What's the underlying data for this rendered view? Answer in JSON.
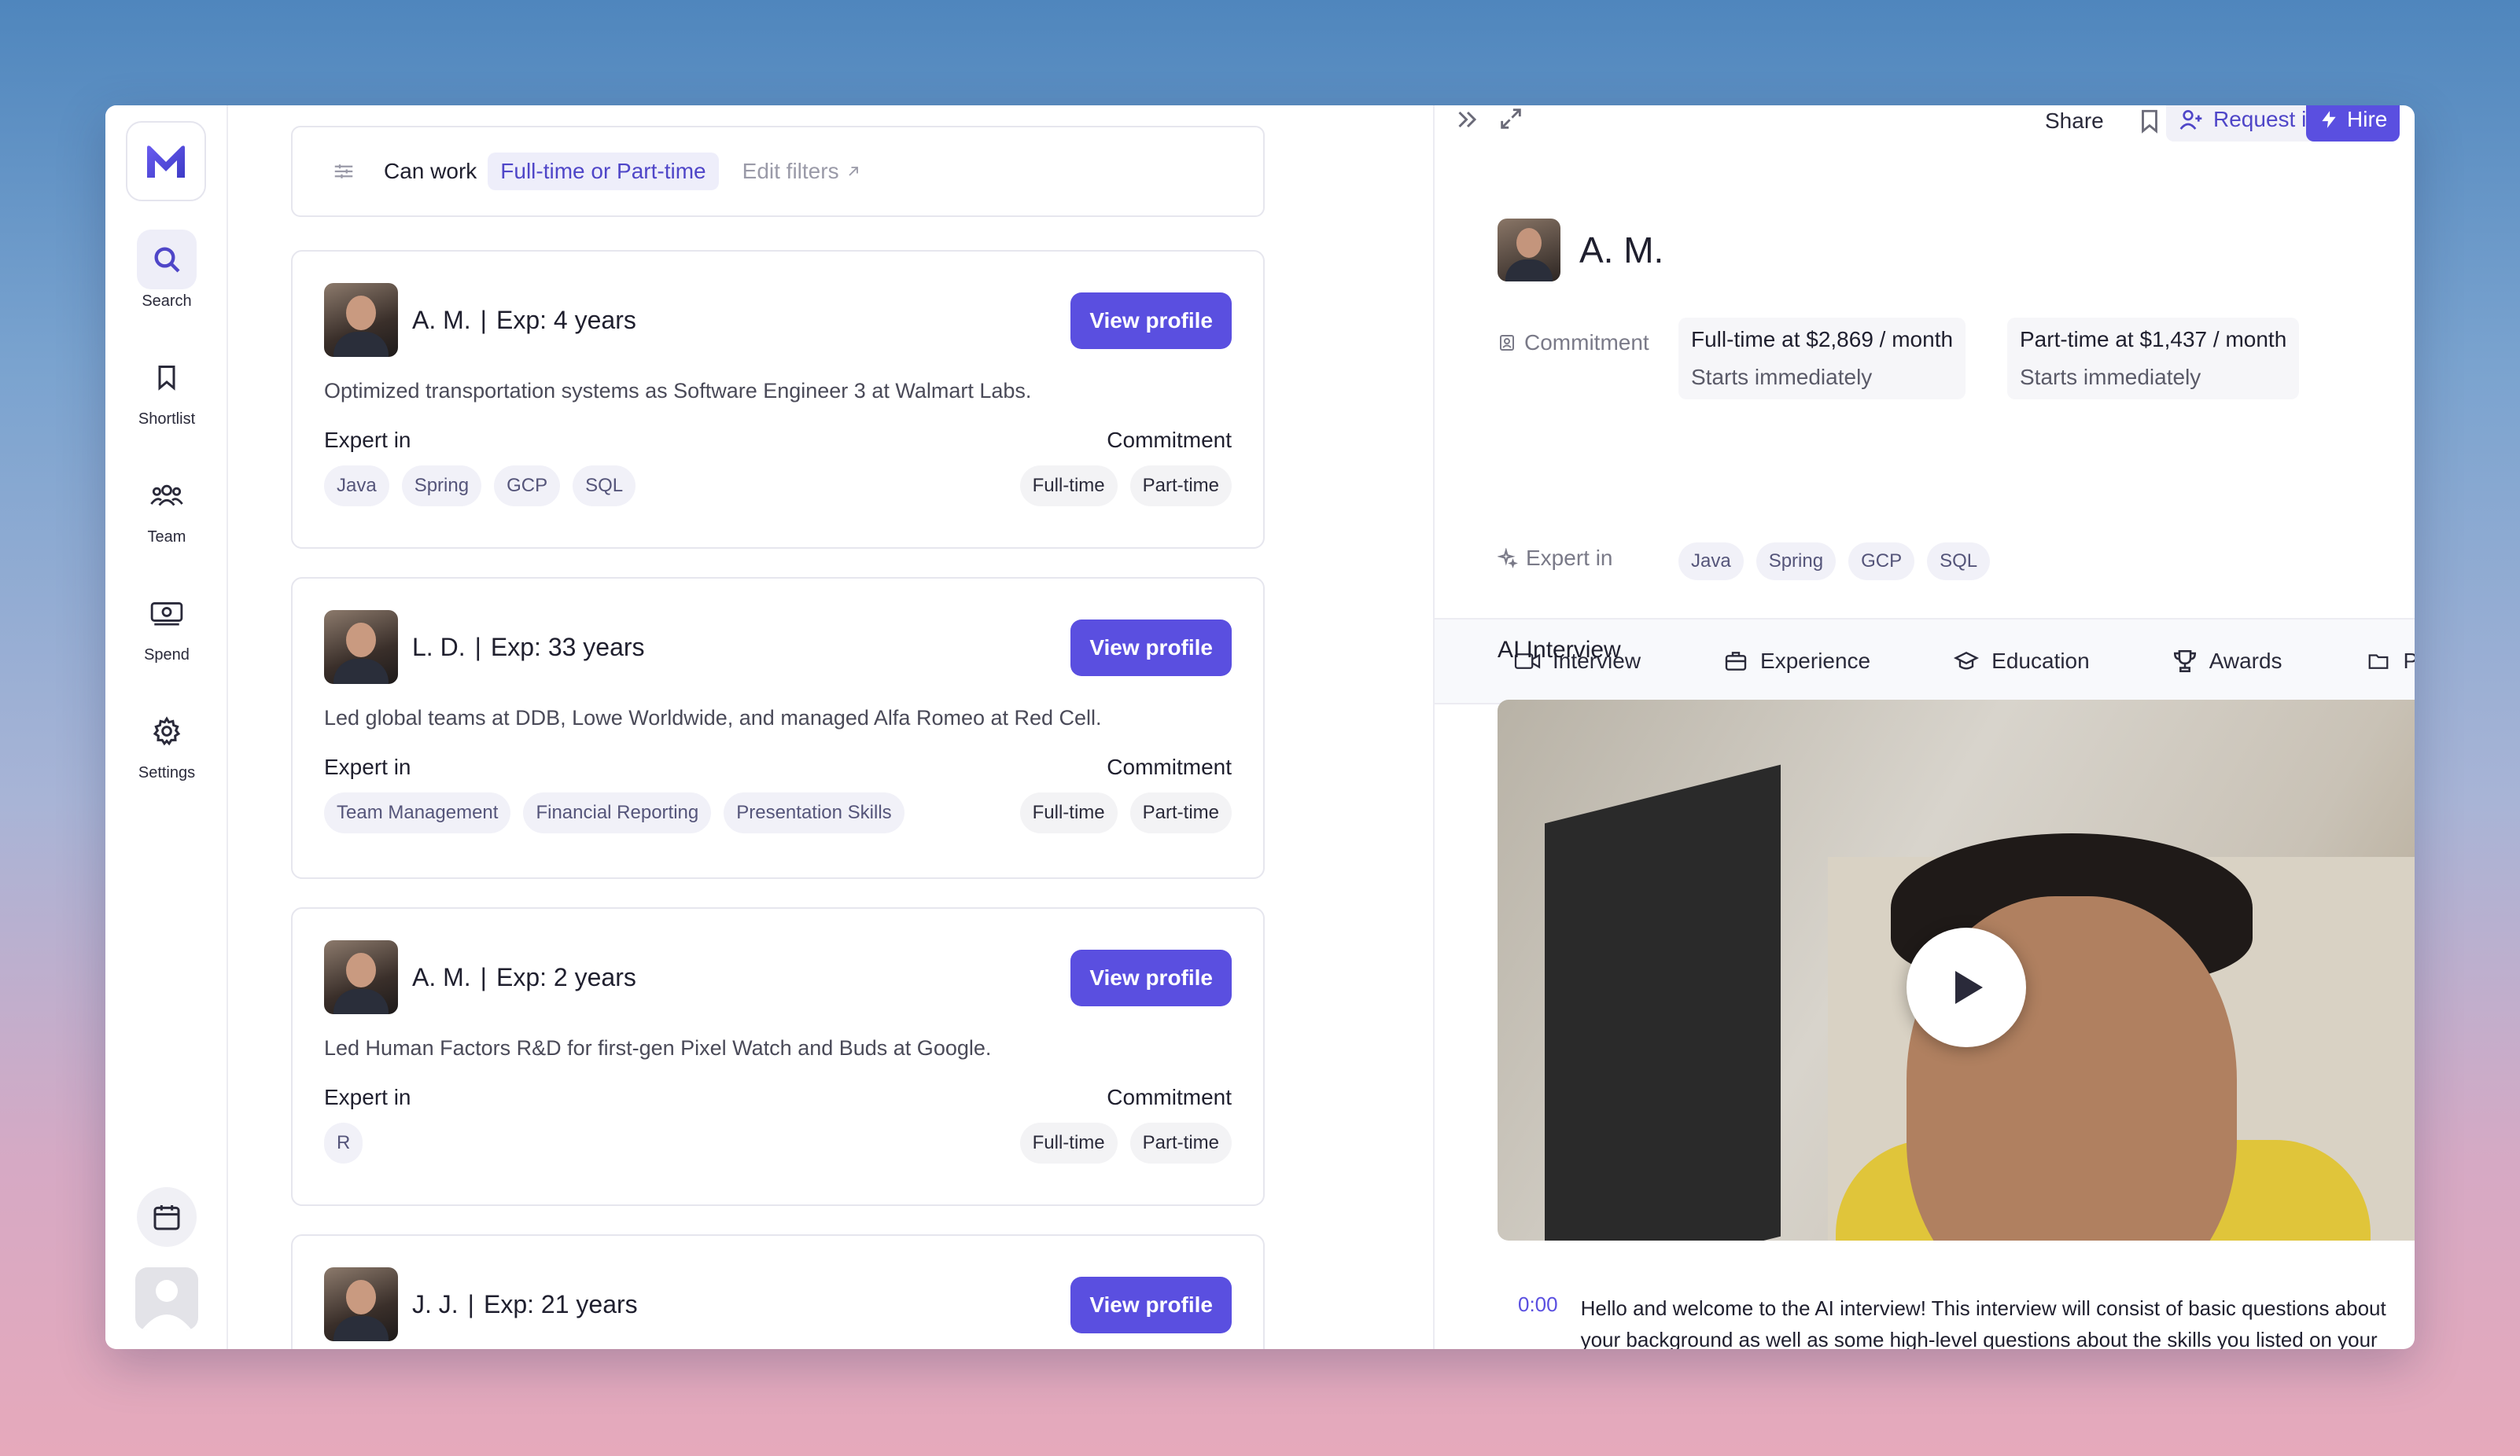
{
  "sidebar": {
    "logo": "M",
    "items": [
      {
        "label": "Search",
        "icon": "search-icon"
      },
      {
        "label": "Shortlist",
        "icon": "bookmark-icon"
      },
      {
        "label": "Team",
        "icon": "team-icon"
      },
      {
        "label": "Spend",
        "icon": "money-icon"
      },
      {
        "label": "Settings",
        "icon": "gear-icon"
      }
    ]
  },
  "filter": {
    "label": "Can work",
    "value": "Full-time or Part-time",
    "edit": "Edit filters"
  },
  "candidates": [
    {
      "name": "A. M.",
      "exp": "Exp: 4 years",
      "button": "View profile",
      "desc": "Optimized transportation systems as Software Engineer 3 at Walmart Labs.",
      "expert_label": "Expert in",
      "commit_label": "Commitment",
      "skills": [
        "Java",
        "Spring",
        "GCP",
        "SQL"
      ],
      "commitments": [
        "Full-time",
        "Part-time"
      ]
    },
    {
      "name": "L. D.",
      "exp": "Exp: 33 years",
      "button": "View profile",
      "desc": "Led global teams at DDB, Lowe Worldwide, and managed Alfa Romeo at Red Cell.",
      "expert_label": "Expert in",
      "commit_label": "Commitment",
      "skills": [
        "Team Management",
        "Financial Reporting",
        "Presentation Skills"
      ],
      "commitments": [
        "Full-time",
        "Part-time"
      ]
    },
    {
      "name": "A. M.",
      "exp": "Exp: 2 years",
      "button": "View profile",
      "desc": "Led Human Factors R&D for first-gen Pixel Watch and Buds at Google.",
      "expert_label": "Expert in",
      "commit_label": "Commitment",
      "skills": [
        "R"
      ],
      "commitments": [
        "Full-time",
        "Part-time"
      ]
    },
    {
      "name": "J. J.",
      "exp": "Exp: 21 years",
      "button": "View profile"
    }
  ],
  "detail": {
    "topbar": {
      "share": "Share",
      "request": "Request intro",
      "hire": "Hire"
    },
    "name": "A. M.",
    "commitment_label": "Commitment",
    "commitments": [
      {
        "title": "Full-time at $2,869 / month",
        "start": "Starts immediately"
      },
      {
        "title": "Part-time at $1,437 / month",
        "start": "Starts immediately"
      }
    ],
    "expert_label": "Expert in",
    "skills": [
      "Java",
      "Spring",
      "GCP",
      "SQL"
    ],
    "tabs": [
      "Interview",
      "Experience",
      "Education",
      "Awards",
      "Proje"
    ],
    "section_title": "AI Interview",
    "transcript": {
      "time": "0:00",
      "text": "Hello and welcome to the AI interview! This interview will consist of basic questions about your background as well as some high-level questions about the skills you listed on your"
    }
  },
  "colors": {
    "accent": "#5a4fe0",
    "accent_light": "#eeeefa"
  }
}
